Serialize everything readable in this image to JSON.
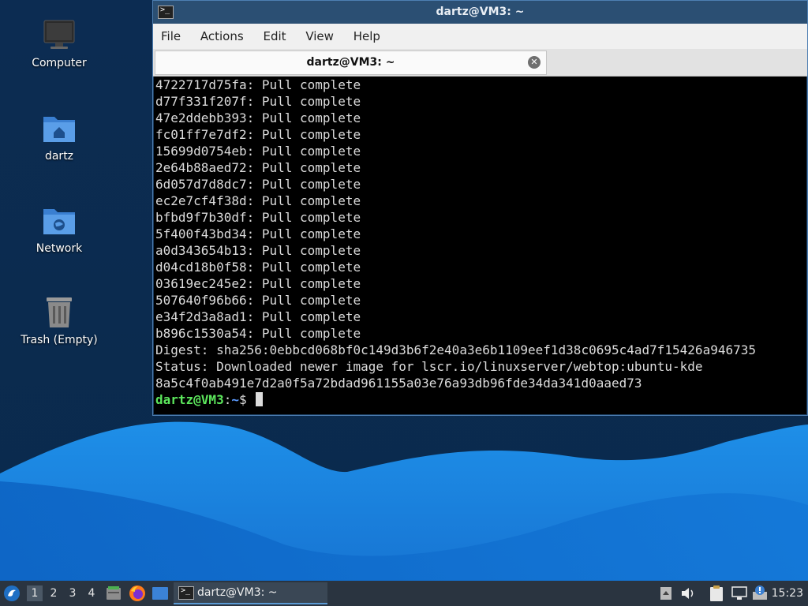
{
  "desktop": {
    "icons": [
      {
        "label": "Computer",
        "icon": "computer-icon"
      },
      {
        "label": "dartz",
        "icon": "home-folder-icon"
      },
      {
        "label": "Network",
        "icon": "network-folder-icon"
      },
      {
        "label": "Trash (Empty)",
        "icon": "trash-icon"
      }
    ]
  },
  "window": {
    "title": "dartz@VM3: ~",
    "menu": [
      "File",
      "Actions",
      "Edit",
      "View",
      "Help"
    ],
    "tab_label": "dartz@VM3: ~",
    "tab_close": "✕"
  },
  "terminal": {
    "lines": [
      "4722717d75fa: Pull complete",
      "d77f331f207f: Pull complete",
      "47e2ddebb393: Pull complete",
      "fc01ff7e7df2: Pull complete",
      "15699d0754eb: Pull complete",
      "2e64b88aed72: Pull complete",
      "6d057d7d8dc7: Pull complete",
      "ec2e7cf4f38d: Pull complete",
      "bfbd9f7b30df: Pull complete",
      "5f400f43bd34: Pull complete",
      "a0d343654b13: Pull complete",
      "d04cd18b0f58: Pull complete",
      "03619ec245e2: Pull complete",
      "507640f96b66: Pull complete",
      "e34f2d3a8ad1: Pull complete",
      "b896c1530a54: Pull complete",
      "Digest: sha256:0ebbcd068bf0c149d3b6f2e40a3e6b1109eef1d38c0695c4ad7f15426a946735",
      "Status: Downloaded newer image for lscr.io/linuxserver/webtop:ubuntu-kde",
      "8a5c4f0ab491e7d2a0f5a72bdad961155a03e76a93db96fde34da341d0aaed73"
    ],
    "prompt_user": "dartz@VM3",
    "prompt_sep": ":",
    "prompt_path": "~",
    "prompt_symbol": "$ "
  },
  "taskbar": {
    "workspaces": [
      "1",
      "2",
      "3",
      "4"
    ],
    "active_workspace": "1",
    "task_label": "dartz@VM3: ~",
    "clock": "15:23"
  },
  "colors": {
    "prompt_user": "#5ce65c",
    "prompt_path": "#5b9bff",
    "accent": "#5b9bd5"
  }
}
